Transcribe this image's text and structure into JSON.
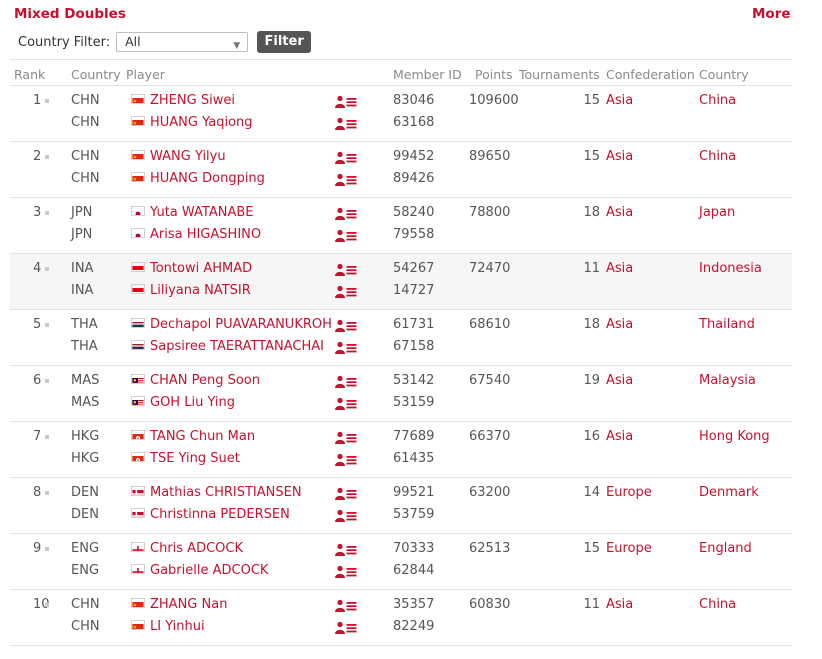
{
  "section": {
    "title": "Mixed Doubles",
    "more_label": "More"
  },
  "filter": {
    "label": "Country Filter:",
    "selected": "All",
    "button_label": "Filter"
  },
  "headers": {
    "rank": "Rank",
    "country_code": "Country",
    "player": "Player",
    "member_id": "Member ID",
    "points": "Points",
    "tournaments": "Tournaments",
    "confederation": "Confederation",
    "country": "Country"
  },
  "colors": {
    "accent": "#c8102e",
    "alt_row": "#f6f6f6",
    "button": "#555555"
  },
  "rankings": [
    {
      "rank": "1",
      "points": "109600",
      "tournaments": "15",
      "confederation": "Asia",
      "country": "China",
      "players": [
        {
          "code": "CHN",
          "flag": "flag-china-icon",
          "name": "ZHENG Siwei",
          "member_id": "83046"
        },
        {
          "code": "CHN",
          "flag": "flag-china-icon",
          "name": "HUANG Yaqiong",
          "member_id": "63168"
        }
      ]
    },
    {
      "rank": "2",
      "points": "89650",
      "tournaments": "15",
      "confederation": "Asia",
      "country": "China",
      "players": [
        {
          "code": "CHN",
          "flag": "flag-china-icon",
          "name": "WANG Yilyu",
          "member_id": "99452"
        },
        {
          "code": "CHN",
          "flag": "flag-china-icon",
          "name": "HUANG Dongping",
          "member_id": "89426"
        }
      ]
    },
    {
      "rank": "3",
      "points": "78800",
      "tournaments": "18",
      "confederation": "Asia",
      "country": "Japan",
      "players": [
        {
          "code": "JPN",
          "flag": "flag-japan-icon",
          "name": "Yuta WATANABE",
          "member_id": "58240"
        },
        {
          "code": "JPN",
          "flag": "flag-japan-icon",
          "name": "Arisa HIGASHINO",
          "member_id": "79558"
        }
      ]
    },
    {
      "rank": "4",
      "points": "72470",
      "tournaments": "11",
      "confederation": "Asia",
      "country": "Indonesia",
      "players": [
        {
          "code": "INA",
          "flag": "flag-indonesia-icon",
          "name": "Tontowi AHMAD",
          "member_id": "54267"
        },
        {
          "code": "INA",
          "flag": "flag-indonesia-icon",
          "name": "Liliyana NATSIR",
          "member_id": "14727"
        }
      ]
    },
    {
      "rank": "5",
      "points": "68610",
      "tournaments": "18",
      "confederation": "Asia",
      "country": "Thailand",
      "players": [
        {
          "code": "THA",
          "flag": "flag-thailand-icon",
          "name": "Dechapol PUAVARANUKROH",
          "member_id": "61731"
        },
        {
          "code": "THA",
          "flag": "flag-thailand-icon",
          "name": "Sapsiree TAERATTANACHAI",
          "member_id": "67158"
        }
      ]
    },
    {
      "rank": "6",
      "points": "67540",
      "tournaments": "19",
      "confederation": "Asia",
      "country": "Malaysia",
      "players": [
        {
          "code": "MAS",
          "flag": "flag-malaysia-icon",
          "name": "CHAN Peng Soon",
          "member_id": "53142"
        },
        {
          "code": "MAS",
          "flag": "flag-malaysia-icon",
          "name": "GOH Liu Ying",
          "member_id": "53159"
        }
      ]
    },
    {
      "rank": "7",
      "points": "66370",
      "tournaments": "16",
      "confederation": "Asia",
      "country": "Hong Kong",
      "players": [
        {
          "code": "HKG",
          "flag": "flag-hong-kong-icon",
          "name": "TANG Chun Man",
          "member_id": "77689"
        },
        {
          "code": "HKG",
          "flag": "flag-hong-kong-icon",
          "name": "TSE Ying Suet",
          "member_id": "61435"
        }
      ]
    },
    {
      "rank": "8",
      "points": "63200",
      "tournaments": "14",
      "confederation": "Europe",
      "country": "Denmark",
      "players": [
        {
          "code": "DEN",
          "flag": "flag-denmark-icon",
          "name": "Mathias CHRISTIANSEN",
          "member_id": "99521"
        },
        {
          "code": "DEN",
          "flag": "flag-denmark-icon",
          "name": "Christinna PEDERSEN",
          "member_id": "53759"
        }
      ]
    },
    {
      "rank": "9",
      "points": "62513",
      "tournaments": "15",
      "confederation": "Europe",
      "country": "England",
      "players": [
        {
          "code": "ENG",
          "flag": "flag-england-icon",
          "name": "Chris ADCOCK",
          "member_id": "70333"
        },
        {
          "code": "ENG",
          "flag": "flag-england-icon",
          "name": "Gabrielle ADCOCK",
          "member_id": "62844"
        }
      ]
    },
    {
      "rank": "10",
      "points": "60830",
      "tournaments": "11",
      "confederation": "Asia",
      "country": "China",
      "players": [
        {
          "code": "CHN",
          "flag": "flag-china-icon",
          "name": "ZHANG Nan",
          "member_id": "35357"
        },
        {
          "code": "CHN",
          "flag": "flag-china-icon",
          "name": "LI Yinhui",
          "member_id": "82249"
        }
      ]
    }
  ]
}
